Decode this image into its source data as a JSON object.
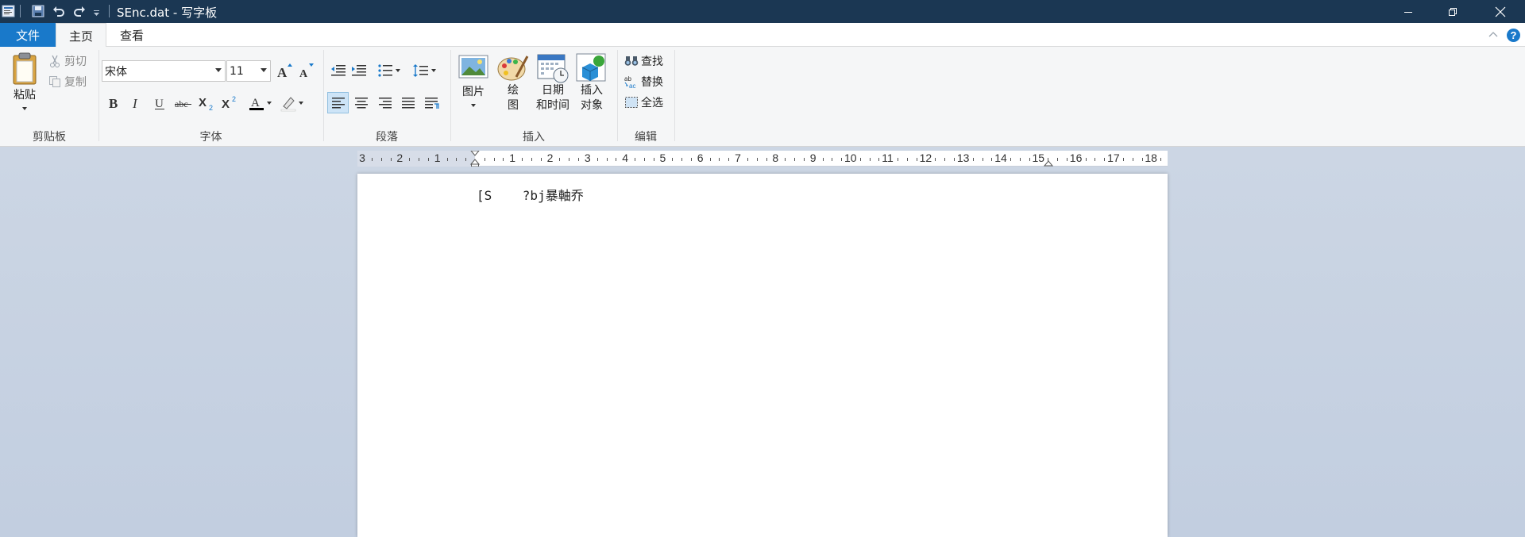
{
  "window": {
    "title": "SEnc.dat - 写字板"
  },
  "tabs": {
    "file": "文件",
    "home": "主页",
    "view": "查看"
  },
  "clipboard": {
    "paste": "粘贴",
    "cut": "剪切",
    "copy": "复制",
    "group_label": "剪贴板"
  },
  "font": {
    "family": "宋体",
    "size": "11",
    "group_label": "字体"
  },
  "paragraph": {
    "group_label": "段落"
  },
  "insert": {
    "picture": "图片",
    "paint_line1": "绘",
    "paint_line2": "图",
    "datetime_line1": "日期",
    "datetime_line2": "和时间",
    "object_line1": "插入",
    "object_line2": "对象",
    "group_label": "插入"
  },
  "editing": {
    "find": "查找",
    "replace": "替换",
    "select_all": "全选",
    "group_label": "编辑"
  },
  "ruler": {
    "left_numbers": [
      "3",
      "2",
      "1"
    ],
    "right_numbers": [
      "1",
      "2",
      "3",
      "4",
      "5",
      "6",
      "7",
      "8",
      "9",
      "10",
      "11",
      "12",
      "13",
      "14",
      "15",
      "16",
      "17",
      "18"
    ]
  },
  "document": {
    "text": "[S    ?bj暴軸乔"
  },
  "colors": {
    "titlebar": "#1b3753",
    "file_tab": "#1979ca",
    "ribbon": "#f5f6f7",
    "workspace": "#c8d3e3"
  }
}
